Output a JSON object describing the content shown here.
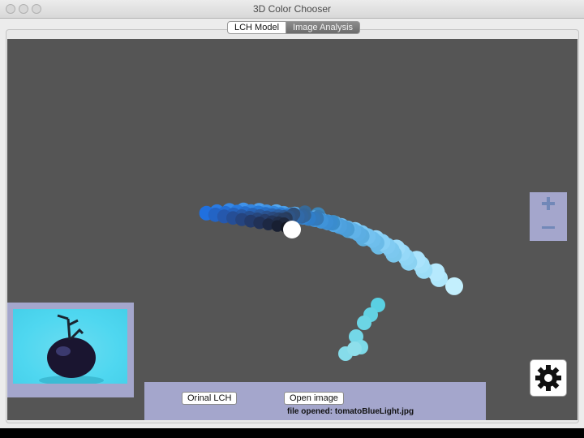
{
  "window": {
    "title": "3D Color Chooser"
  },
  "tabs": [
    {
      "label": "LCH Model",
      "selected": false
    },
    {
      "label": "Image Analysis",
      "selected": true
    }
  ],
  "zoom": {
    "plus_icon": "plus-icon",
    "minus_icon": "minus-icon"
  },
  "settings": {
    "icon": "gear-icon"
  },
  "thumbnail": {
    "description_icon": "tomato-image"
  },
  "bottom_bar": {
    "original_lch_label": "Orinal LCH",
    "open_image_label": "Open image",
    "status_text": "file opened: tomatoBlueLight.jpg"
  },
  "colors": {
    "stage_bg": "#555555",
    "control_panel_bg": "#a4a6cc",
    "selected_marker": "#ffffff"
  }
}
